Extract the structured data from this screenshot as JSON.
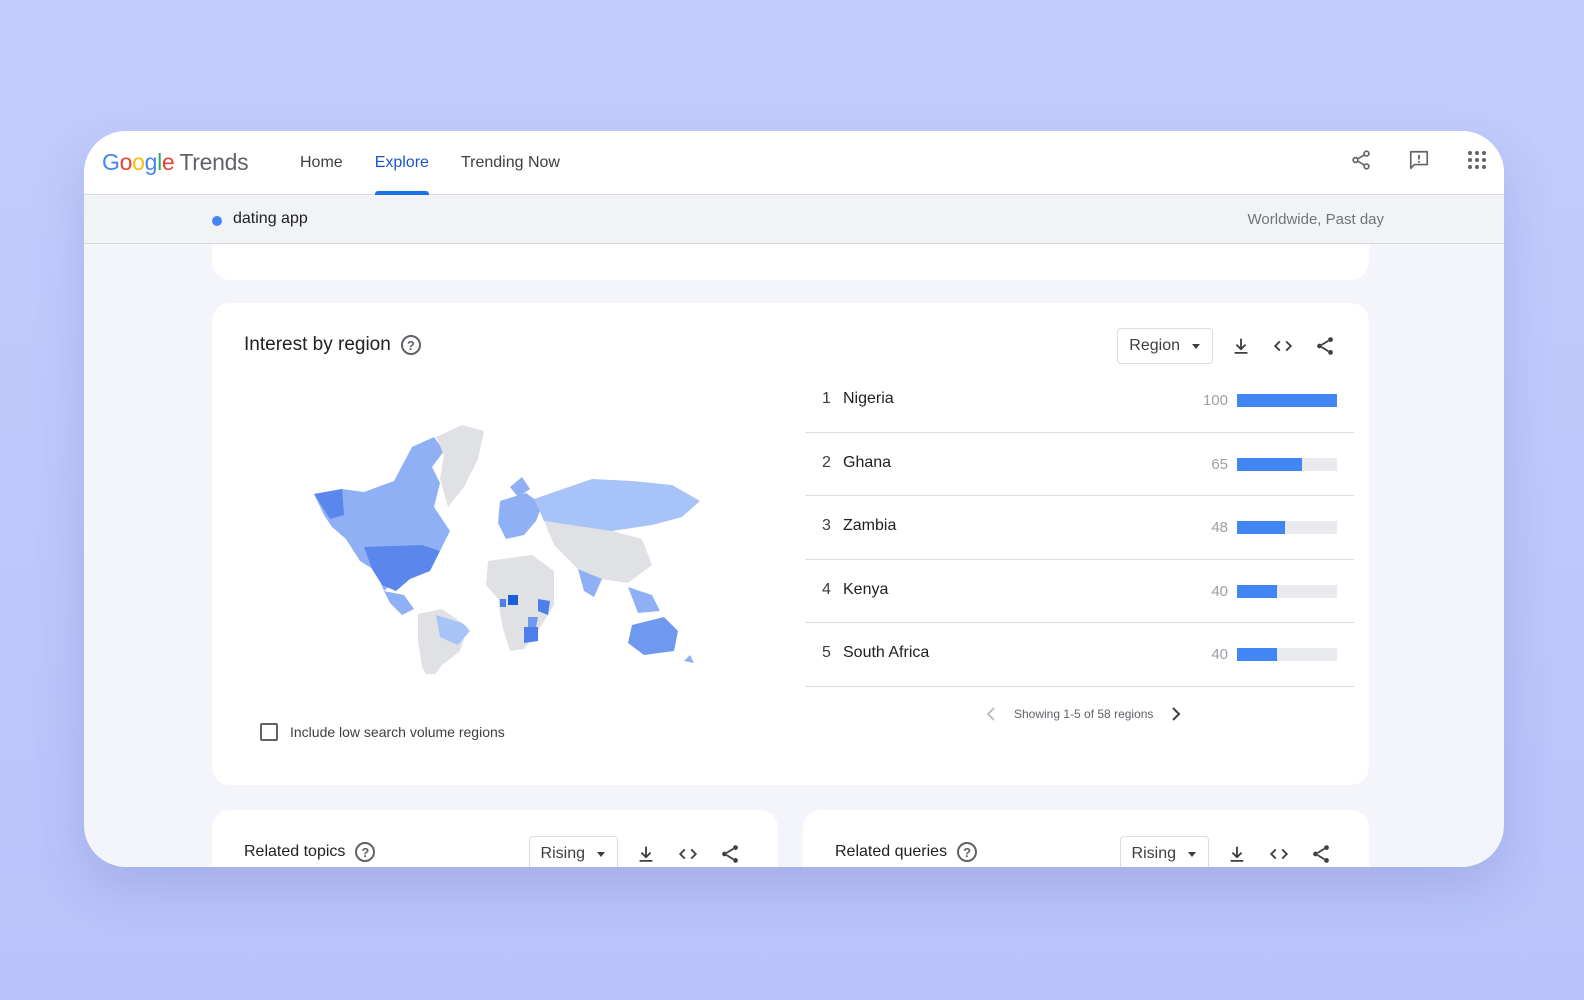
{
  "brand": {
    "logo": "Google",
    "product": "Trends"
  },
  "nav": {
    "tabs": [
      {
        "label": "Home"
      },
      {
        "label": "Explore"
      },
      {
        "label": "Trending Now"
      }
    ],
    "active": "Explore"
  },
  "top_icons": [
    "share-icon",
    "feedback-icon",
    "apps-grid-icon"
  ],
  "query": {
    "term": "dating app",
    "dot_color": "#4285f4",
    "meta": "Worldwide, Past day"
  },
  "interest_by_region": {
    "title": "Interest by region",
    "help": "?",
    "dropdown": "Region",
    "regions": [
      {
        "rank": "1",
        "name": "Nigeria",
        "value": 100
      },
      {
        "rank": "2",
        "name": "Ghana",
        "value": 65
      },
      {
        "rank": "3",
        "name": "Zambia",
        "value": 48
      },
      {
        "rank": "4",
        "name": "Kenya",
        "value": 40
      },
      {
        "rank": "5",
        "name": "South Africa",
        "value": 40
      }
    ],
    "pager_text": "Showing 1-5 of 58 regions",
    "checkbox_label": "Include low search volume regions",
    "checkbox_checked": false
  },
  "related_topics": {
    "title": "Related topics",
    "help": "?",
    "dropdown": "Rising"
  },
  "related_queries": {
    "title": "Related queries",
    "help": "?",
    "dropdown": "Rising"
  },
  "colors": {
    "accent": "#1a73e8",
    "bar": "#4285f4",
    "bar_track": "#e8eaed",
    "background": "#c3cdfd"
  }
}
